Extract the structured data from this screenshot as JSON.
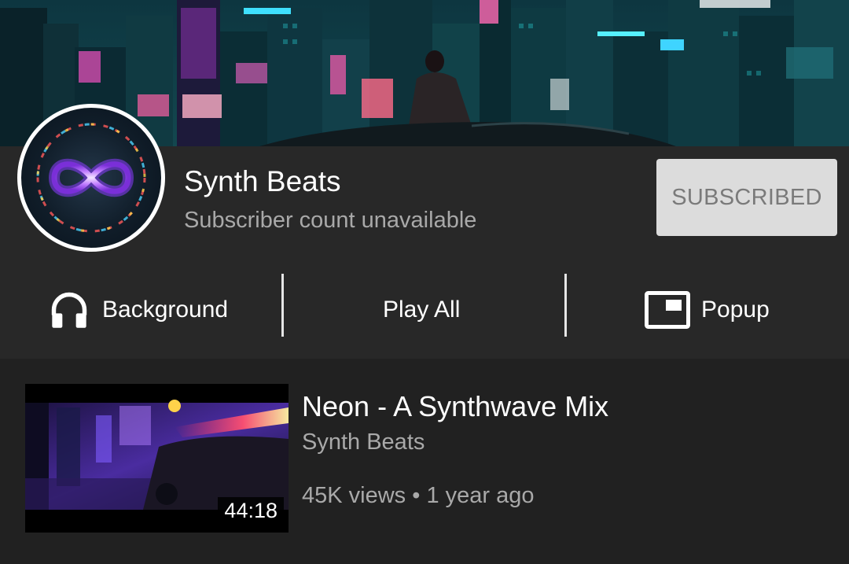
{
  "channel": {
    "name": "Synth Beats",
    "subscriber_text": "Subscriber count unavailable",
    "subscribe_label": "SUBSCRIBED",
    "banner_icon": "cyberpunk-city-banner",
    "avatar_icon": "infinity-logo"
  },
  "actions": [
    {
      "label": "Background",
      "icon": "headphones-icon"
    },
    {
      "label": "Play All"
    },
    {
      "label": "Popup",
      "icon": "popup-icon"
    }
  ],
  "videos": [
    {
      "title": "Neon - A Synthwave Mix",
      "channel": "Synth Beats",
      "views": "45K views",
      "separator": "•",
      "age": "1 year ago",
      "duration": "44:18"
    }
  ],
  "colors": {
    "background": "#212121",
    "header": "#282828",
    "secondary_text": "#a9a9a9",
    "subscribed_button": "#dcdcdc",
    "subscribed_text": "#7a7a7a"
  }
}
